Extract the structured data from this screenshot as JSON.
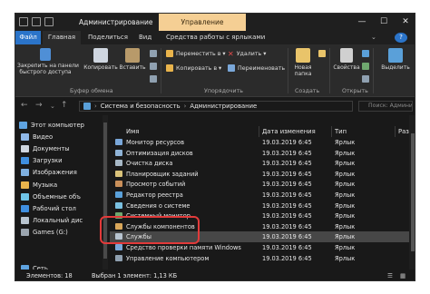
{
  "window": {
    "title": "Администрирование",
    "context_tab": "Управление",
    "controls": [
      "—",
      "☐",
      "✕"
    ]
  },
  "ribbon_tabs": [
    "Файл",
    "Главная",
    "Поделиться",
    "Вид",
    "Средства работы с ярлыками"
  ],
  "ribbon": {
    "pin_label": "Закрепить на панели быстрого доступа",
    "pin_label_l1": "Закрепить на панели",
    "pin_label_l2": "быстрого доступа",
    "copy": "Копировать",
    "paste": "Вставить",
    "move_to": "Переместить в ▾",
    "copy_to": "Копировать в ▾",
    "delete": "Удалить ▾",
    "rename": "Переименовать",
    "new_folder_l1": "Новая",
    "new_folder_l2": "папка",
    "properties": "Свойства",
    "select": "Выделить",
    "group_clipboard": "Буфер обмена",
    "group_organize": "Упорядочить",
    "group_create": "Создать",
    "group_open": "Открыть"
  },
  "address": {
    "crumbs": [
      "Система и безопасность",
      "Администрирование"
    ],
    "search_placeholder": "Поиск: Администрирование"
  },
  "nav": {
    "items": [
      {
        "label": "Этот компьютер",
        "icon": "computer-icon",
        "color": "#5ea3e0"
      },
      {
        "label": "Видео",
        "icon": "video-folder-icon",
        "color": "#8fb8e8"
      },
      {
        "label": "Документы",
        "icon": "documents-folder-icon",
        "color": "#cfd6e0"
      },
      {
        "label": "Загрузки",
        "icon": "downloads-folder-icon",
        "color": "#3f8fe0"
      },
      {
        "label": "Изображения",
        "icon": "pictures-folder-icon",
        "color": "#7fb0e0"
      },
      {
        "label": "Музыка",
        "icon": "music-folder-icon",
        "color": "#e9b44c"
      },
      {
        "label": "Объемные объ",
        "icon": "3d-objects-folder-icon",
        "color": "#6fc4e8"
      },
      {
        "label": "Рабочий стол",
        "icon": "desktop-folder-icon",
        "color": "#3f8fe0"
      },
      {
        "label": "Локальный дис",
        "icon": "local-disk-icon",
        "color": "#b8c4d0"
      },
      {
        "label": "Games (G:)",
        "icon": "drive-icon",
        "color": "#9aa4ae"
      },
      {
        "label": "Сеть",
        "icon": "network-icon",
        "color": "#5ea3e0"
      }
    ]
  },
  "list": {
    "headers": {
      "name": "Имя",
      "date": "Дата изменения",
      "type": "Тип",
      "size": "Размер"
    },
    "rows": [
      {
        "name": "Монитор ресурсов",
        "date": "19.03.2019 6:45",
        "type": "Ярлык",
        "color": "#7aa7d9"
      },
      {
        "name": "Оптимизация дисков",
        "date": "19.03.2019 6:45",
        "type": "Ярлык",
        "color": "#8fb3d6"
      },
      {
        "name": "Очистка диска",
        "date": "19.03.2019 6:45",
        "type": "Ярлык",
        "color": "#a7b8c6"
      },
      {
        "name": "Планировщик заданий",
        "date": "19.03.2019 6:45",
        "type": "Ярлык",
        "color": "#d9c27a"
      },
      {
        "name": "Просмотр событий",
        "date": "19.03.2019 6:45",
        "type": "Ярлык",
        "color": "#c98f5a"
      },
      {
        "name": "Редактор реестра",
        "date": "19.03.2019 6:45",
        "type": "Ярлык",
        "color": "#5aa0d9"
      },
      {
        "name": "Сведения о системе",
        "date": "19.03.2019 6:45",
        "type": "Ярлык",
        "color": "#7ac0e0"
      },
      {
        "name": "Системный монитор",
        "date": "19.03.2019 6:45",
        "type": "Ярлык",
        "color": "#6fa86f"
      },
      {
        "name": "Службы компонентов",
        "date": "19.03.2019 6:45",
        "type": "Ярлык",
        "color": "#d9a75a"
      },
      {
        "name": "Службы",
        "date": "19.03.2019 6:45",
        "type": "Ярлык",
        "color": "#b8c4d0",
        "selected": true
      },
      {
        "name": "Средство проверки памяти Windows",
        "date": "19.03.2019 6:45",
        "type": "Ярлык",
        "color": "#7aa7d9"
      },
      {
        "name": "Управление компьютером",
        "date": "19.03.2019 6:45",
        "type": "Ярлык",
        "color": "#8fa0b0"
      }
    ]
  },
  "status": {
    "count": "Элементов: 18",
    "selected": "Выбран 1 элемент: 1,13 КБ"
  },
  "colors": {
    "file_tab": "#2b74c9",
    "context_tab": "#f5cf94",
    "highlight": "#e23a3a"
  }
}
